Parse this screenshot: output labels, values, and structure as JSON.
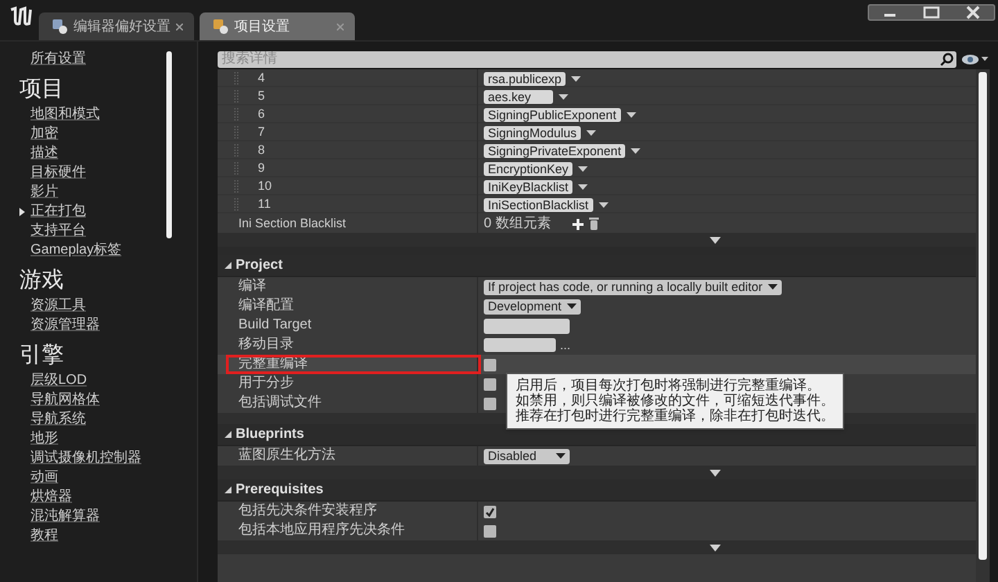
{
  "window": {
    "tabs": [
      {
        "label": "编辑器偏好设置",
        "selected": false
      },
      {
        "label": "项目设置",
        "selected": true
      }
    ]
  },
  "sidebar": {
    "top_item": "所有设置",
    "sections": [
      {
        "title": "项目",
        "items": [
          {
            "label": "地图和模式",
            "kind": "link"
          },
          {
            "label": "加密",
            "kind": "link"
          },
          {
            "label": "描述",
            "kind": "link"
          },
          {
            "label": "目标硬件",
            "kind": "link"
          },
          {
            "label": "影片",
            "kind": "link"
          },
          {
            "label": "正在打包",
            "kind": "group"
          },
          {
            "label": "支持平台",
            "kind": "link"
          },
          {
            "label": "Gameplay标签",
            "kind": "link"
          }
        ]
      },
      {
        "title": "游戏",
        "items": [
          {
            "label": "资源工具",
            "kind": "link"
          },
          {
            "label": "资源管理器",
            "kind": "link"
          }
        ]
      },
      {
        "title": "引擎",
        "items": [
          {
            "label": "层级LOD",
            "kind": "link"
          },
          {
            "label": "导航网格体",
            "kind": "link"
          },
          {
            "label": "导航系统",
            "kind": "link"
          },
          {
            "label": "地形",
            "kind": "link"
          },
          {
            "label": "调试摄像机控制器",
            "kind": "link"
          },
          {
            "label": "动画",
            "kind": "link"
          },
          {
            "label": "烘焙器",
            "kind": "link"
          },
          {
            "label": "混沌解算器",
            "kind": "link"
          },
          {
            "label": "教程",
            "kind": "link"
          }
        ]
      }
    ]
  },
  "details": {
    "search": {
      "placeholder": "搜索详情"
    },
    "array_items": [
      {
        "index": "4",
        "value": "rsa.publicexp"
      },
      {
        "index": "5",
        "value": "aes.key"
      },
      {
        "index": "6",
        "value": "SigningPublicExponent"
      },
      {
        "index": "7",
        "value": "SigningModulus"
      },
      {
        "index": "8",
        "value": "SigningPrivateExponent"
      },
      {
        "index": "9",
        "value": "EncryptionKey"
      },
      {
        "index": "10",
        "value": "IniKeyBlacklist"
      },
      {
        "index": "11",
        "value": "IniSectionBlacklist"
      }
    ],
    "array_property": {
      "label": "Ini Section Blacklist",
      "count": "0 数组元素"
    },
    "categories": [
      {
        "title": "Project",
        "expanded": true,
        "advanced_toggle": false,
        "rows": [
          {
            "label": "编译",
            "kind": "dropdown",
            "value": "If project has code, or running a locally built editor",
            "highlighted": false
          },
          {
            "label": "编译配置",
            "kind": "dropdown",
            "value": "Development",
            "highlighted": false
          },
          {
            "label": "Build Target",
            "kind": "text_field",
            "highlighted": false
          },
          {
            "label": "移动目录",
            "kind": "path_field",
            "browse": "...",
            "highlighted": false
          },
          {
            "label": "完整重编译",
            "kind": "checkbox",
            "checked": false,
            "highlighted": true
          },
          {
            "label": "用于分步",
            "kind": "checkbox",
            "checked": false,
            "highlighted": false
          },
          {
            "label": "包括调试文件",
            "kind": "checkbox",
            "checked": false,
            "highlighted": false
          }
        ]
      },
      {
        "title": "Blueprints",
        "expanded": true,
        "advanced_toggle": true,
        "rows": [
          {
            "label": "蓝图原生化方法",
            "kind": "dropdown",
            "value": "Disabled",
            "highlighted": false
          }
        ]
      },
      {
        "title": "Prerequisites",
        "expanded": true,
        "advanced_toggle": true,
        "rows": [
          {
            "label": "包括先决条件安装程序",
            "kind": "checkbox",
            "checked": true,
            "highlighted": false
          },
          {
            "label": "包括本地应用程序先决条件",
            "kind": "checkbox",
            "checked": false,
            "highlighted": false
          }
        ]
      }
    ]
  },
  "tooltip": {
    "lines": [
      "启用后，项目每次打包时将强制进行完整重编译。",
      "如禁用，则只编译被修改的文件，可缩短迭代事件。",
      "推荐在打包时进行完整重编译，除非在打包时迭代。"
    ]
  }
}
